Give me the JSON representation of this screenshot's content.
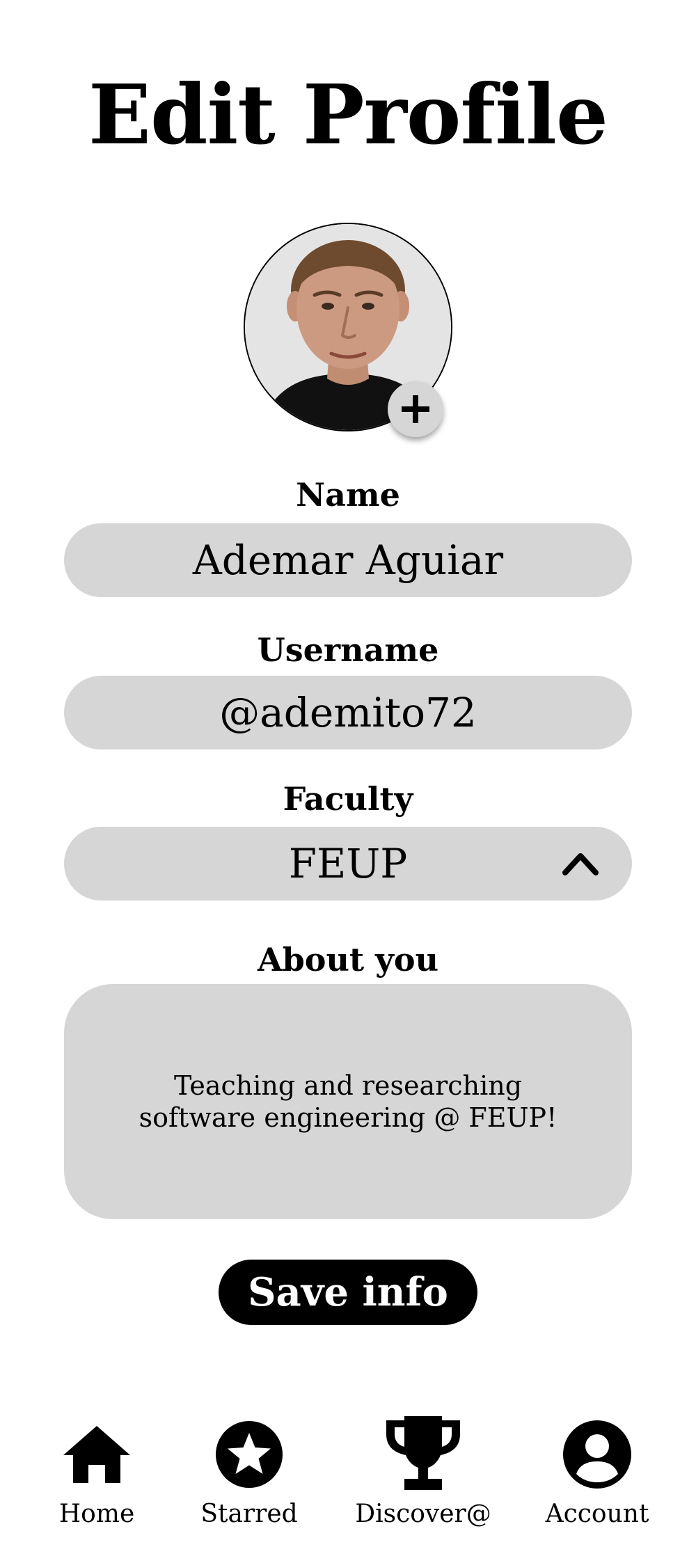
{
  "page": {
    "title": "Edit Profile"
  },
  "avatar": {
    "add_icon": "plus-icon"
  },
  "form": {
    "name": {
      "label": "Name",
      "value": "Ademar Aguiar"
    },
    "username": {
      "label": "Username",
      "value": "@ademito72"
    },
    "faculty": {
      "label": "Faculty",
      "value": "FEUP",
      "icon": "chevron-up-icon"
    },
    "about": {
      "label": "About you",
      "value": "Teaching and researching software engineering @ FEUP!"
    }
  },
  "actions": {
    "save_label": "Save info"
  },
  "bottom_nav": {
    "items": [
      {
        "label": "Home",
        "icon": "home-icon"
      },
      {
        "label": "Starred",
        "icon": "star-icon"
      },
      {
        "label": "Discover@",
        "icon": "trophy-icon"
      },
      {
        "label": "Account",
        "icon": "account-icon"
      }
    ]
  }
}
